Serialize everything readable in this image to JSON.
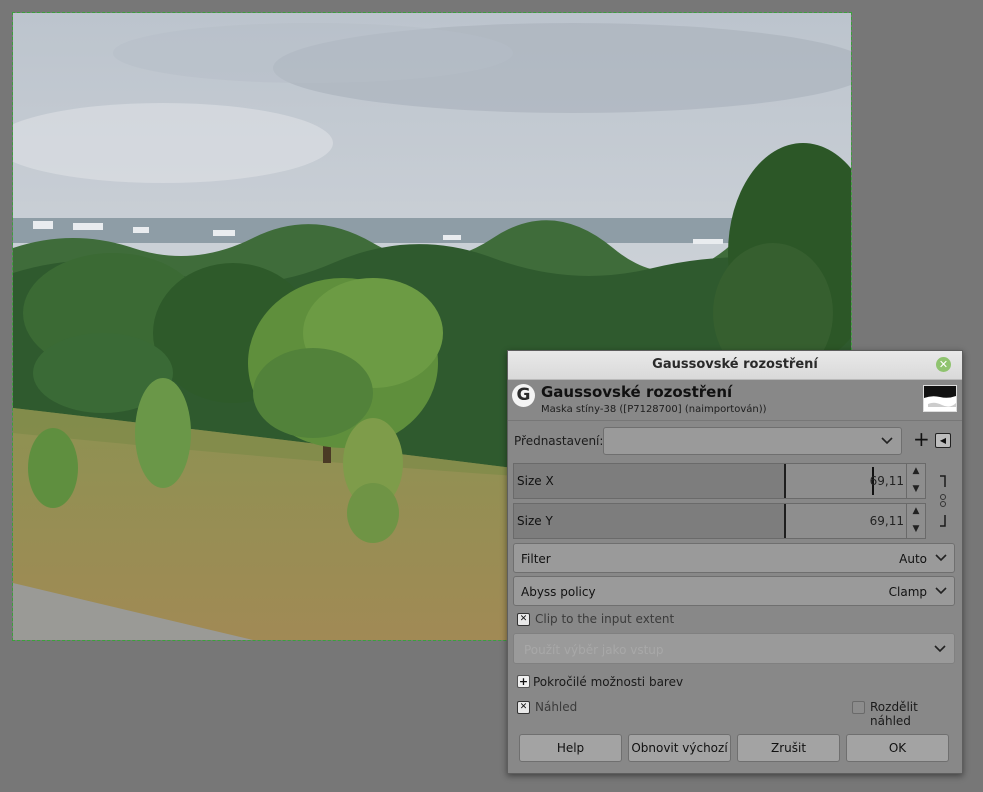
{
  "dialog": {
    "window_title": "Gaussovské rozostření",
    "operation_title": "Gaussovské rozostření",
    "layer_info": "Maska stíny-38 ([P7128700] (naimportován))",
    "presets_label": "Přednastavení:",
    "presets_value": "",
    "size_x": {
      "label": "Size X",
      "value": "69,11",
      "fraction": 0.656
    },
    "size_y": {
      "label": "Size Y",
      "value": "69,11",
      "fraction": 0.656
    },
    "filter": {
      "label": "Filter",
      "value": "Auto"
    },
    "abyss": {
      "label": "Abyss policy",
      "value": "Clamp"
    },
    "clip_label": "Clip to the input extent",
    "clip_checked": true,
    "input_placeholder": "Použít výběr jako vstup",
    "advanced_label": "Pokročilé možnosti barev",
    "preview_label": "Náhled",
    "preview_checked": true,
    "split_label": "Rozdělit náhled",
    "split_checked": false,
    "buttons": {
      "help": "Help",
      "reset": "Obnovit výchozí",
      "cancel": "Zrušit",
      "ok": "OK"
    }
  },
  "icons": {
    "close": "close-icon",
    "logo": "gegl-logo-icon",
    "add_preset": "plus-icon",
    "preset_menu": "menu-left-icon",
    "chain": "chain-link-icon",
    "check": "check-x-icon"
  },
  "colors": {
    "workspace_bg": "#777777",
    "dialog_bg": "#888888",
    "selection_outline": "#3aa33a",
    "close_button": "#8fc36f"
  }
}
